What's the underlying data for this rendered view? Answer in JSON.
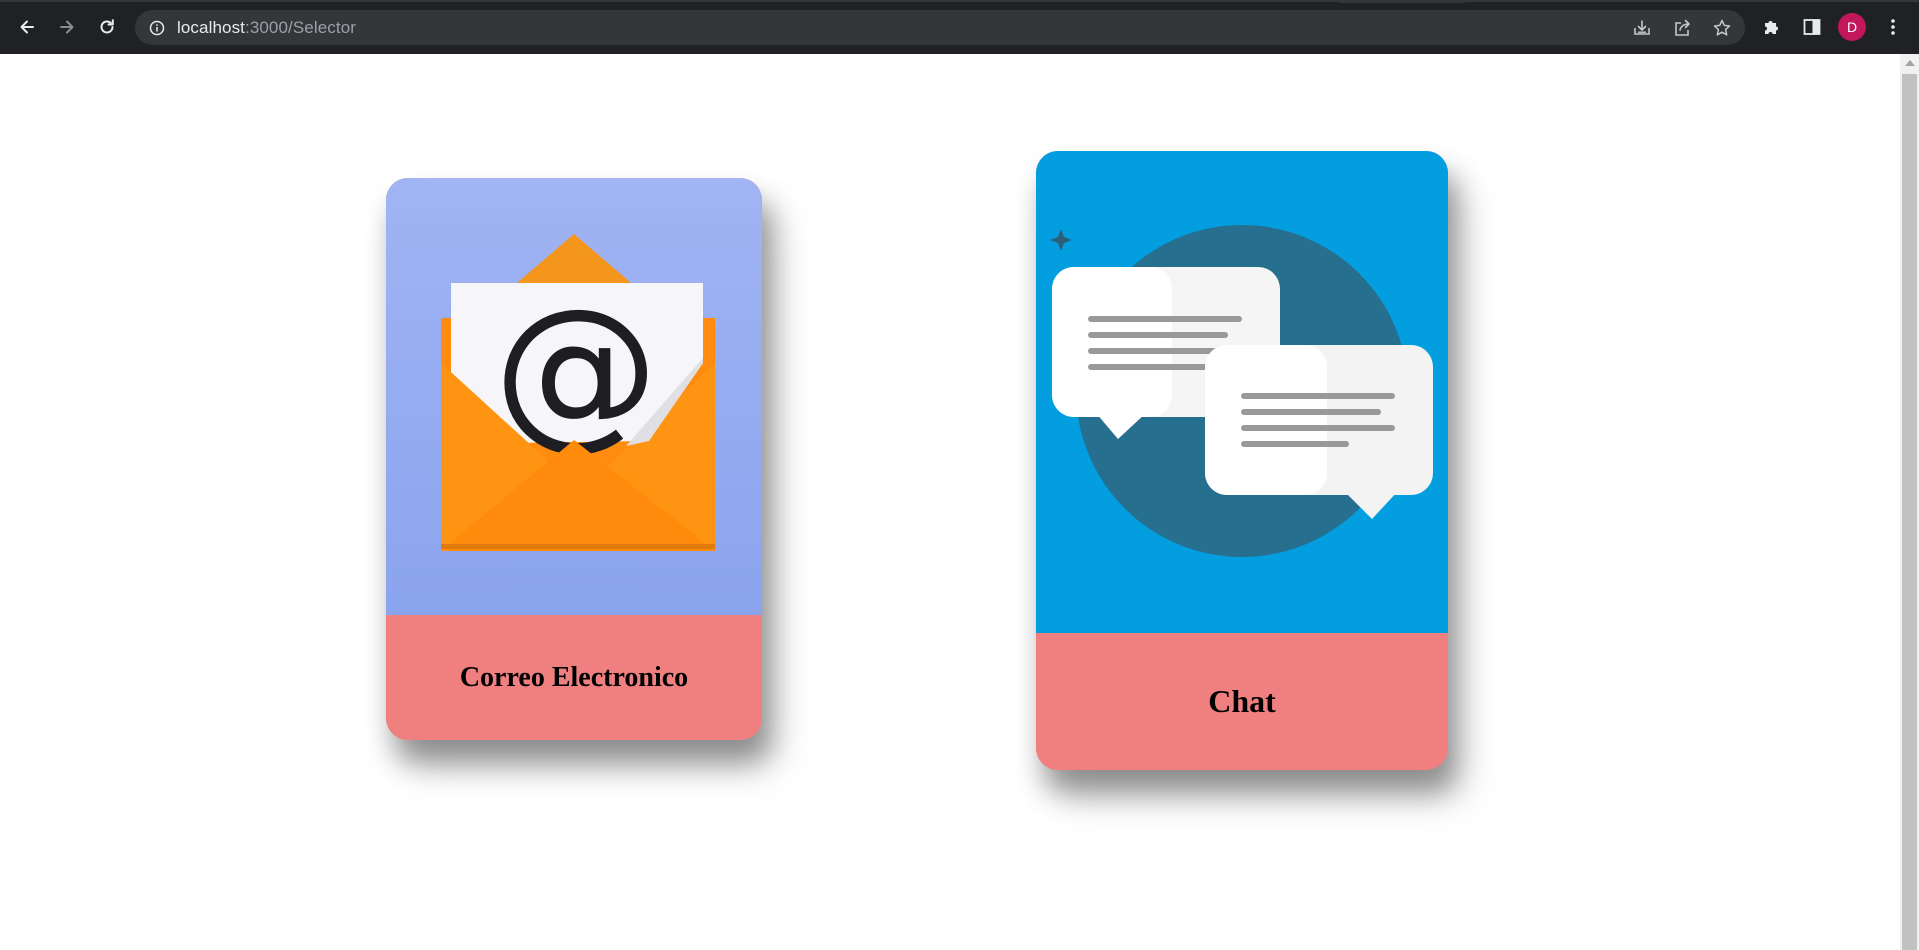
{
  "browser": {
    "url_host": "localhost",
    "url_path": ":3000/Selector",
    "profile_initial": "D",
    "icons": {
      "back": "arrow-left-icon",
      "forward": "arrow-right-icon",
      "reload": "reload-icon",
      "site_info": "info-icon",
      "install": "download-icon",
      "share": "share-icon",
      "bookmark": "star-icon",
      "extensions": "puzzle-icon",
      "side_panel": "side-panel-icon",
      "menu": "kebab-menu-icon"
    }
  },
  "cards": [
    {
      "label": "Correo Electronico",
      "image": "email-envelope-at-icon",
      "image_bg": "#9bb0f2",
      "footer_bg": "#f08080"
    },
    {
      "label": "Chat",
      "image": "chat-bubbles-icon",
      "image_bg": "#039ee0",
      "footer_bg": "#f08080"
    }
  ]
}
